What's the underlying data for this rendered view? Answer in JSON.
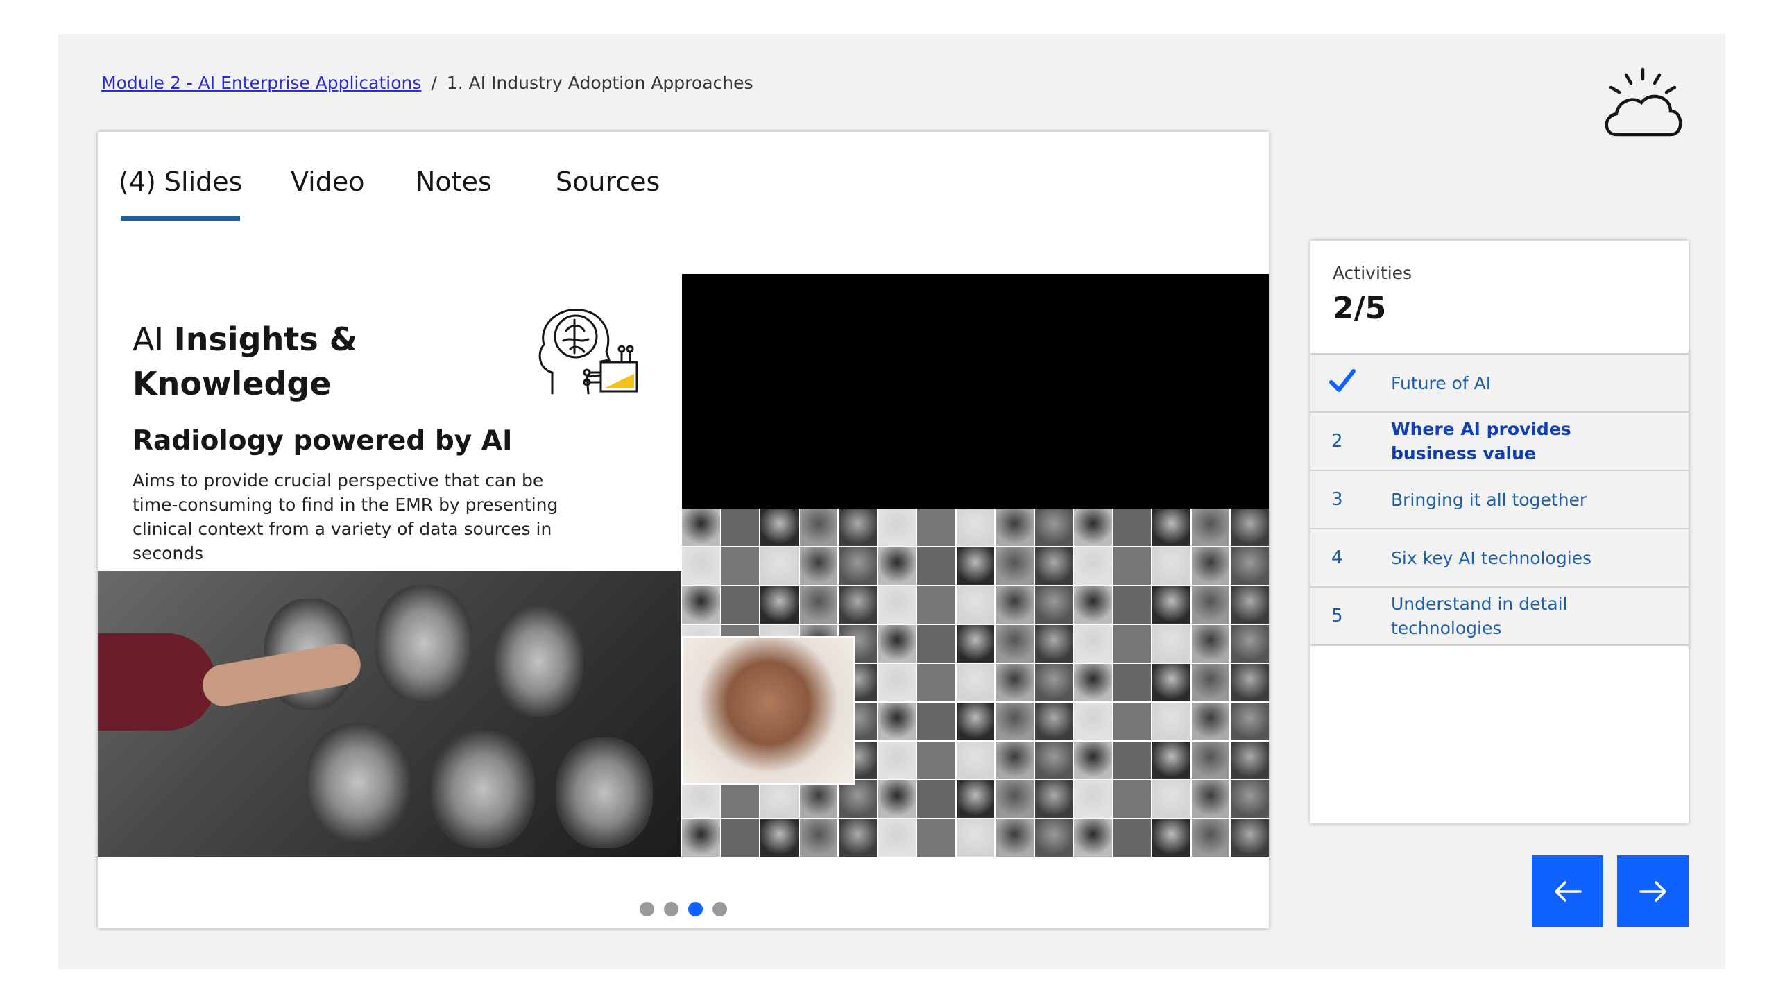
{
  "breadcrumb": {
    "module_link": "Module 2 - AI Enterprise Applications",
    "separator": "/",
    "current": "1. AI Industry Adoption Approaches"
  },
  "tabs": [
    {
      "label": "(4) Slides",
      "active": true
    },
    {
      "label": "Video",
      "active": false
    },
    {
      "label": "Notes",
      "active": false
    },
    {
      "label": "Sources",
      "active": false
    }
  ],
  "slide": {
    "title_light": "AI ",
    "title_bold": "Insights &",
    "title_line2": "Knowledge",
    "subtitle": "Radiology powered by AI",
    "body": "Aims to provide crucial perspective that can be time-consuming to find in the EMR by presenting clinical context from a variety of data sources in seconds"
  },
  "pager": {
    "count": 4,
    "active_index": 2
  },
  "activities": {
    "label": "Activities",
    "count": "2/5",
    "items": [
      {
        "num": "",
        "title": "Future of AI",
        "completed": true,
        "current": false
      },
      {
        "num": "2",
        "title": "Where AI provides business value",
        "completed": false,
        "current": true
      },
      {
        "num": "3",
        "title": "Bringing it all together",
        "completed": false,
        "current": false
      },
      {
        "num": "4",
        "title": "Six key AI technologies",
        "completed": false,
        "current": false
      },
      {
        "num": "5",
        "title": "Understand in detail technologies",
        "completed": false,
        "current": false
      }
    ]
  },
  "icons": {
    "logo": "ibm-cloud-icon",
    "slide_icon": "brain-ai-icon",
    "check": "checkmark-icon",
    "prev": "arrow-left-icon",
    "next": "arrow-right-icon"
  },
  "colors": {
    "accent": "#0f62fe",
    "link": "#1f5fa8",
    "tab_underline": "#1f5fa8",
    "stage_bg": "#f2f2f2"
  }
}
